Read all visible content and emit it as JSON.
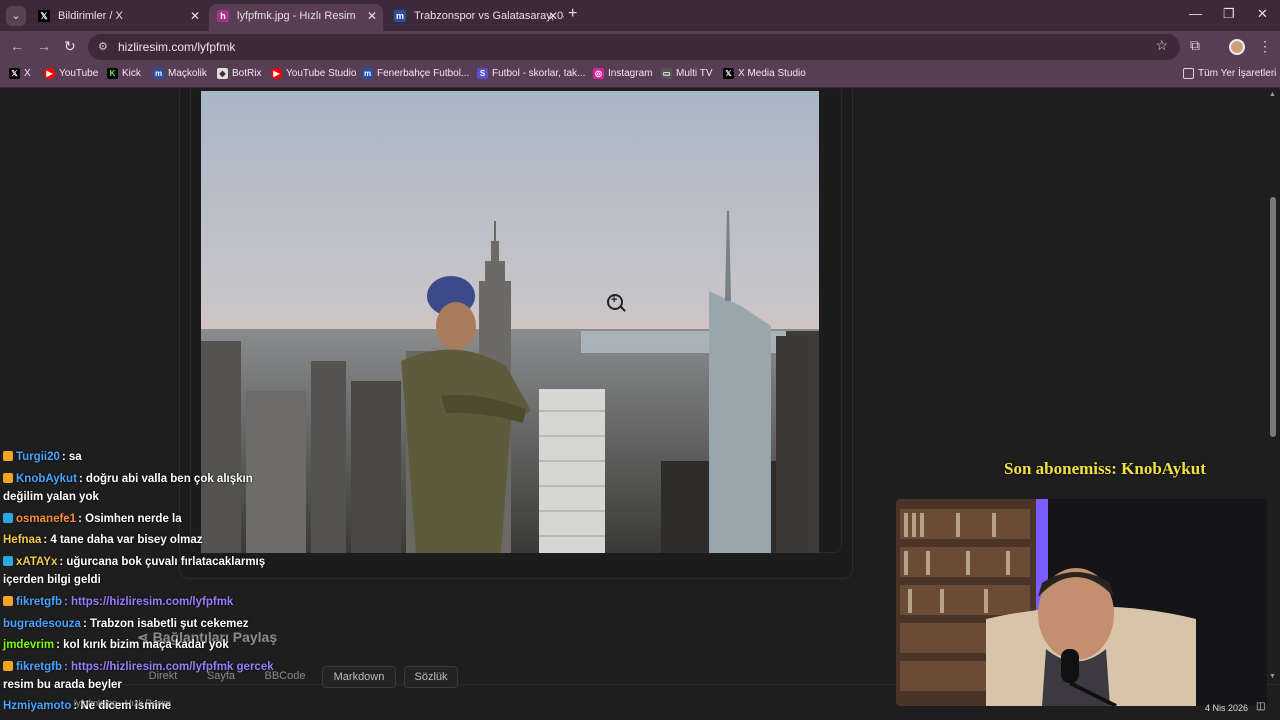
{
  "tabs": [
    {
      "title": "Bildirimler / X",
      "favicon": "x-icon"
    },
    {
      "title": "lyfpfmk.jpg - Hızlı Resim",
      "favicon": "hizliresim-icon"
    },
    {
      "title": "Trabzonspor vs Galatasaray, 04.",
      "favicon": "mackolik-icon"
    }
  ],
  "address_bar": {
    "url": "hizliresim.com/lyfpfmk"
  },
  "bookmarks": [
    {
      "label": "X",
      "icon": "x-icon",
      "color": "#000000"
    },
    {
      "label": "YouTube",
      "icon": "youtube-icon",
      "color": "#ff0000"
    },
    {
      "label": "Kick",
      "icon": "kick-icon",
      "color": "#53fc18"
    },
    {
      "label": "Maçkolik",
      "icon": "mackolik-icon",
      "color": "#2a4ea0"
    },
    {
      "label": "BotRix",
      "icon": "botrix-icon",
      "color": "#dddddd"
    },
    {
      "label": "YouTube Studio",
      "icon": "youtube-studio-icon",
      "color": "#ff0000"
    },
    {
      "label": "Fenerbahçe Futbol...",
      "icon": "mackolik-icon",
      "color": "#2a4ea0"
    },
    {
      "label": "Futbol - skorlar, tak...",
      "icon": "flashscore-icon",
      "color": "#5a4fcf"
    },
    {
      "label": "Instagram",
      "icon": "instagram-icon",
      "color": "#d6249f"
    },
    {
      "label": "Multi TV",
      "icon": "multitv-icon",
      "color": "#666666"
    },
    {
      "label": "X Media Studio",
      "icon": "x-icon",
      "color": "#000000"
    }
  ],
  "all_bookmarks_label": "Tüm Yer İşaretleri",
  "page": {
    "share_label": "Bağlantıları Paylaş",
    "format_buttons": [
      "Direkt",
      "Sayfa",
      "BBCode",
      "Markdown",
      "Sözlük"
    ]
  },
  "overlay": {
    "last_subscriber": "Son abonemiss: KnobAykut"
  },
  "chat": [
    {
      "user": "Turgii20",
      "text": ": sa",
      "color": "#4aa3ff"
    },
    {
      "user": "KnobAykut",
      "text": ": doğru abi valla ben çok alışkın",
      "color": "#4aa3ff"
    },
    {
      "user": "",
      "text": "değilim yalan yok",
      "color": "#ffffff"
    },
    {
      "user": "osmanefe1",
      "text": ": Osimhen nerde la",
      "color": "#ff8c3a"
    },
    {
      "user": "Hefnaa",
      "text": ": 4 tane daha var bisey olmaz",
      "color": "#f2c94c"
    },
    {
      "user": "xATAYx",
      "text": ": uğurcana bok çuvalı fırlatacaklarmış",
      "color": "#f2c94c"
    },
    {
      "user": "",
      "text": "içerden bilgi geldi",
      "color": "#ffffff"
    },
    {
      "user": "fikretgfb",
      "text": ": https://hizliresim.com/lyfpfmk",
      "color": "#4aa3ff"
    },
    {
      "user": "bugradesouza",
      "text": ": Trabzon isabetli şut cekemez",
      "color": "#4aa3ff"
    },
    {
      "user": "jmdevrim",
      "text": ": kol kırık bizim maça kadar yok",
      "color": "#7cfc00"
    },
    {
      "user": "fikretgfb",
      "text": ": https://hizliresim.com/lyfpfmk gercek",
      "color": "#4aa3ff"
    },
    {
      "user": "",
      "text": "resim bu arada beyler",
      "color": "#ffffff"
    },
    {
      "user": "Hzmiyamoto",
      "text": ": Ne dicem isminе",
      "color": "#4aa3ff"
    }
  ],
  "taskbar": {
    "window_title": "lyfpfmk.jpg - Hızlı Resim",
    "date": "4 Nis 2026"
  }
}
